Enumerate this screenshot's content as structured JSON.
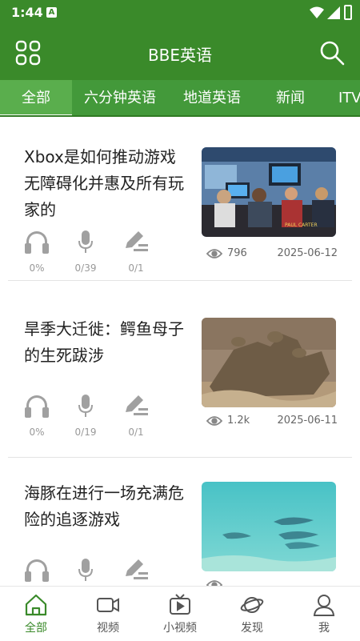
{
  "status_bar": {
    "time": "1:44",
    "notification_letter": "A"
  },
  "app_bar": {
    "title": "BBE英语",
    "left_icon": "grid-menu-icon",
    "right_icon": "search-icon"
  },
  "tabs": [
    {
      "label": "全部",
      "active": true
    },
    {
      "label": "六分钟英语",
      "active": false
    },
    {
      "label": "地道英语",
      "active": false
    },
    {
      "label": "新闻",
      "active": false
    },
    {
      "label": "ITV",
      "active": false
    }
  ],
  "articles": [
    {
      "title": "Xbox是如何推动游戏无障碍化并惠及所有玩家的",
      "listen": "0%",
      "speak": "0/39",
      "write": "0/1",
      "views": "796",
      "date": "2025-06-12",
      "thumb_caption": "PAUL CARTER"
    },
    {
      "title": "旱季大迁徙：鳄鱼母子的生死跋涉",
      "listen": "0%",
      "speak": "0/19",
      "write": "0/1",
      "views": "1.2k",
      "date": "2025-06-11"
    },
    {
      "title": "海豚在进行一场充满危险的追逐游戏",
      "listen": "",
      "speak": "",
      "write": "",
      "views": "",
      "date": ""
    }
  ],
  "bottom_nav": [
    {
      "label": "全部",
      "icon": "home-icon",
      "active": true
    },
    {
      "label": "视频",
      "icon": "video-camera-icon",
      "active": false
    },
    {
      "label": "小视频",
      "icon": "tv-play-icon",
      "active": false
    },
    {
      "label": "发现",
      "icon": "planet-icon",
      "active": false
    },
    {
      "label": "我",
      "icon": "user-icon",
      "active": false
    }
  ],
  "colors": {
    "primary": "#3a8a2a",
    "tab_bar": "#43993a",
    "active_tab": "#5aae4d",
    "icon_gray": "#a0a0a0"
  }
}
